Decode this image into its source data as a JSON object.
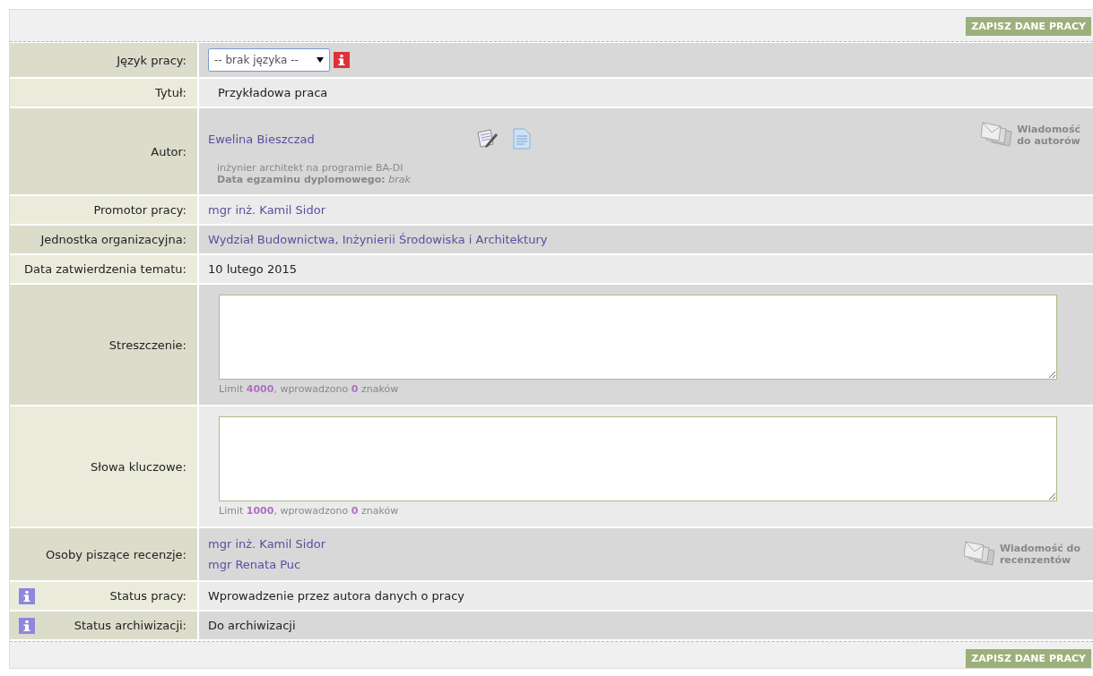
{
  "top_bar": {
    "button": "ZAPISZ DANE PRACY"
  },
  "rows": [
    {
      "kind": "select",
      "label": "Język pracy:",
      "value": "-- brak języka --",
      "info_icon": true
    },
    {
      "kind": "text",
      "label": "Tytuł:",
      "value": "Przykładowa praca"
    },
    {
      "kind": "author",
      "label": "Autor:",
      "name": "Ewelina Bieszczad",
      "program": "inżynier architekt na programie BA-DI",
      "exam": "**Data egzaminu dyplomowego:** *brak*",
      "message": [
        "Wiadomość",
        "do autorów"
      ]
    },
    {
      "kind": "link",
      "label": "Promotor pracy:",
      "value": "mgr inż. Kamil Sidor"
    },
    {
      "kind": "link",
      "label": "Jednostka organizacyjna:",
      "value": "Wydział Budownictwa, Inżynierii Środowiska i Architektury"
    },
    {
      "kind": "text",
      "label": "Data zatwierdzenia tematu:",
      "value": "10 lutego 2015"
    },
    {
      "kind": "textarea",
      "label": "Streszczenie:",
      "counter": "Limit **4000**, wprowadzono **0** znaków"
    },
    {
      "kind": "textarea",
      "label": "Słowa kluczowe:",
      "counter": "Limit **1000**, wprowadzono **0** znaków"
    },
    {
      "kind": "reviewers",
      "label": "Osoby piszące recenzje:",
      "people": [
        "mgr inż. Kamil Sidor",
        "mgr Renata Puc"
      ],
      "message": [
        "Wiadomość do",
        "recenzentów"
      ]
    },
    {
      "kind": "text",
      "label": "Status pracy:",
      "value": "Wprowadzenie przez autora danych o pracy",
      "info_icon": true
    },
    {
      "kind": "text",
      "label": "Status archiwizacji:",
      "value": "Do archiwizacji",
      "info_icon": true
    }
  ],
  "bottom_bar": {
    "button": "ZAPISZ DANE PRACY"
  }
}
